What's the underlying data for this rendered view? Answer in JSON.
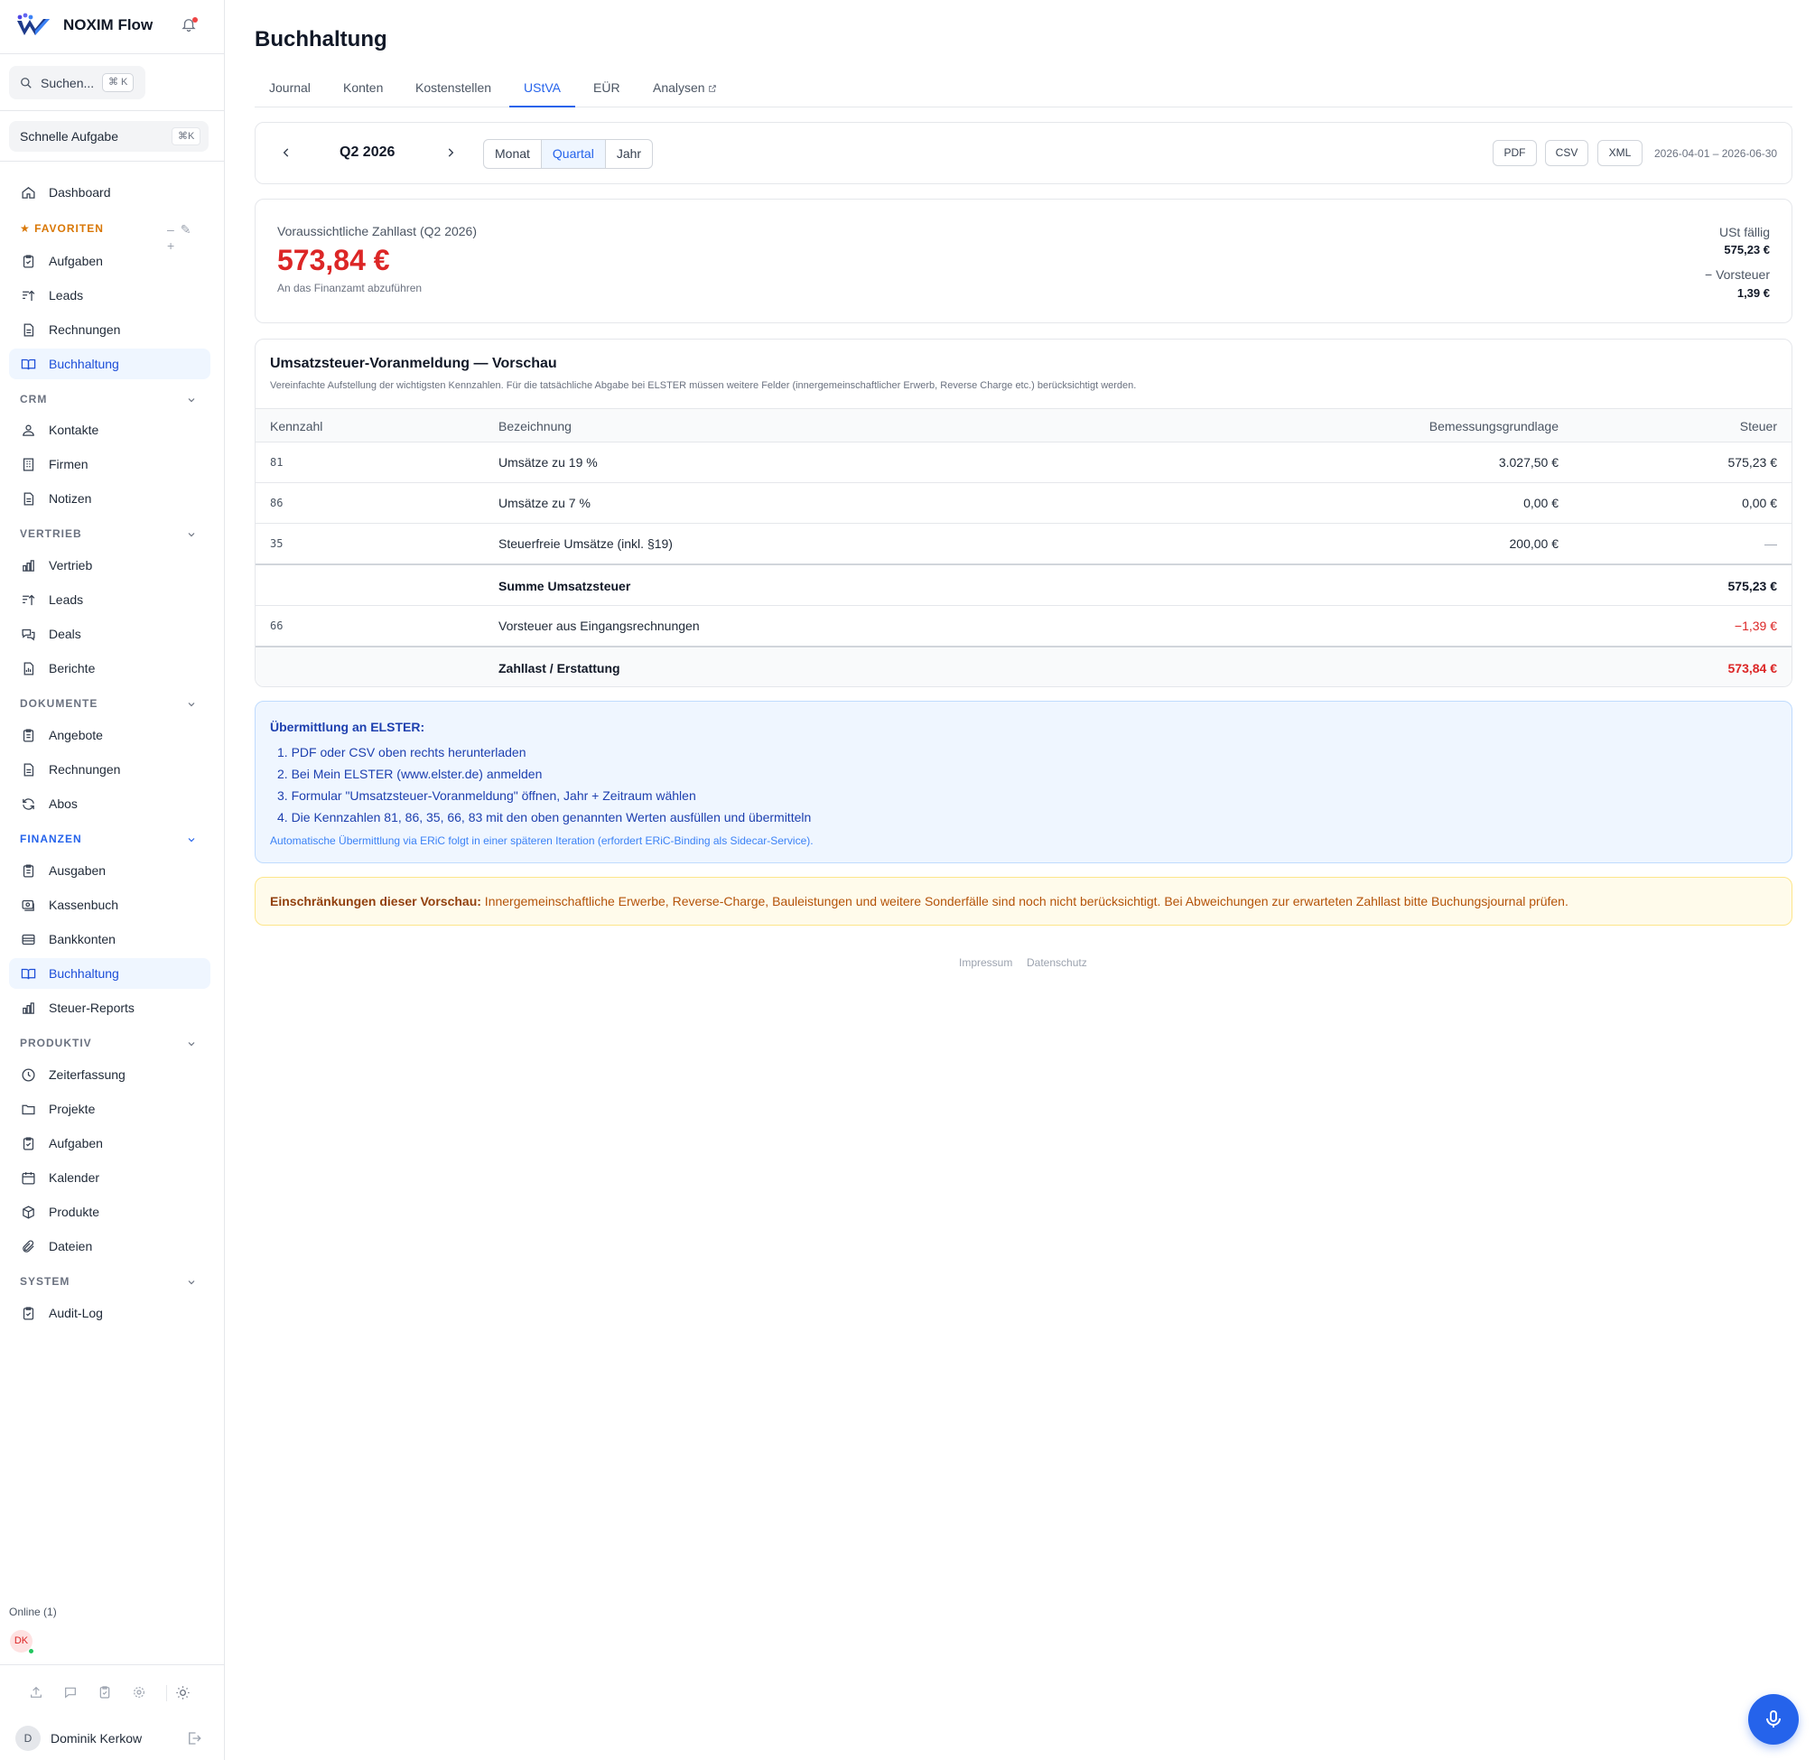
{
  "app": {
    "name": "NOXIM Flow"
  },
  "search": {
    "placeholder": "Suchen...",
    "shortcut": "⌘ K"
  },
  "quick_task": {
    "label": "Schnelle Aufgabe",
    "shortcut": "⌘K"
  },
  "sidebar": {
    "dashboard": "Dashboard",
    "favorites": {
      "title": "★ FAVORITEN",
      "items": [
        "Aufgaben",
        "Leads",
        "Rechnungen",
        "Buchhaltung"
      ]
    },
    "crm": {
      "title": "CRM",
      "items": [
        "Kontakte",
        "Firmen",
        "Notizen"
      ]
    },
    "vertrieb": {
      "title": "VERTRIEB",
      "items": [
        "Vertrieb",
        "Leads",
        "Deals",
        "Berichte"
      ]
    },
    "dokumente": {
      "title": "DOKUMENTE",
      "items": [
        "Angebote",
        "Rechnungen",
        "Abos"
      ]
    },
    "finanzen": {
      "title": "FINANZEN",
      "items": [
        "Ausgaben",
        "Kassenbuch",
        "Bankkonten",
        "Buchhaltung",
        "Steuer-Reports"
      ]
    },
    "produktiv": {
      "title": "PRODUKTIV",
      "items": [
        "Zeiterfassung",
        "Projekte",
        "Aufgaben",
        "Kalender",
        "Produkte",
        "Dateien"
      ]
    },
    "system": {
      "title": "SYSTEM",
      "items": [
        "Audit-Log"
      ]
    },
    "online": "Online (1)",
    "online_user_initials": "DK",
    "user": {
      "initial": "D",
      "name": "Dominik Kerkow"
    }
  },
  "page": {
    "title": "Buchhaltung",
    "tabs": [
      "Journal",
      "Konten",
      "Kostenstellen",
      "UStVA",
      "EÜR",
      "Analysen"
    ],
    "active_tab": "UStVA"
  },
  "period": {
    "label": "Q2 2026",
    "modes": [
      "Monat",
      "Quartal",
      "Jahr"
    ],
    "active_mode": "Quartal",
    "exports": [
      "PDF",
      "CSV",
      "XML"
    ],
    "range": "2026-04-01 – 2026-06-30"
  },
  "summary": {
    "label": "Voraussichtliche Zahllast (Q2 2026)",
    "amount": "573,84 €",
    "subtitle": "An das Finanzamt abzuführen",
    "ust_label": "USt fällig",
    "ust_value": "575,23 €",
    "vorsteuer_label": "− Vorsteuer",
    "vorsteuer_value": "1,39 €"
  },
  "preview": {
    "title": "Umsatzsteuer-Voranmeldung — Vorschau",
    "description": "Vereinfachte Aufstellung der wichtigsten Kennzahlen. Für die tatsächliche Abgabe bei ELSTER müssen weitere Felder (innergemeinschaftlicher Erwerb, Reverse Charge etc.) berücksichtigt werden.",
    "columns": [
      "Kennzahl",
      "Bezeichnung",
      "Bemessungsgrundlage",
      "Steuer"
    ],
    "rows": [
      {
        "code": "81",
        "name": "Umsätze zu 19 %",
        "base": "3.027,50 €",
        "tax": "575,23 €"
      },
      {
        "code": "86",
        "name": "Umsätze zu 7 %",
        "base": "0,00 €",
        "tax": "0,00 €"
      },
      {
        "code": "35",
        "name": "Steuerfreie Umsätze (inkl. §19)",
        "base": "200,00 €",
        "tax": "—"
      },
      {
        "code": "",
        "name": "Summe Umsatzsteuer",
        "base": "",
        "tax": "575,23 €"
      },
      {
        "code": "66",
        "name": "Vorsteuer aus Eingangsrechnungen",
        "base": "",
        "tax": "−1,39 €"
      },
      {
        "code": "",
        "name": "Zahllast / Erstattung",
        "base": "",
        "tax": "573,84 €"
      }
    ]
  },
  "elster": {
    "title": "Übermittlung an ELSTER:",
    "steps": [
      "1. PDF oder CSV oben rechts herunterladen",
      "2. Bei Mein ELSTER (www.elster.de) anmelden",
      "3. Formular \"Umsatzsteuer-Voranmeldung\" öffnen, Jahr + Zeitraum wählen",
      "4. Die Kennzahlen 81, 86, 35, 66, 83 mit den oben genannten Werten ausfüllen und übermitteln"
    ],
    "note": "Automatische Übermittlung via ERiC folgt in einer späteren Iteration (erfordert ERiC-Binding als Sidecar-Service)."
  },
  "warning": {
    "title": "Einschränkungen dieser Vorschau:",
    "text": " Innergemeinschaftliche Erwerbe, Reverse-Charge, Bauleistungen und weitere Sonderfälle sind noch nicht berücksichtigt. Bei Abweichungen zur erwarteten Zahllast bitte Buchungsjournal prüfen."
  },
  "footer": {
    "impressum": "Impressum",
    "datenschutz": "Datenschutz"
  },
  "colors": {
    "accent": "#2563eb",
    "negative": "#dc2626",
    "favorites": "#d97706"
  }
}
